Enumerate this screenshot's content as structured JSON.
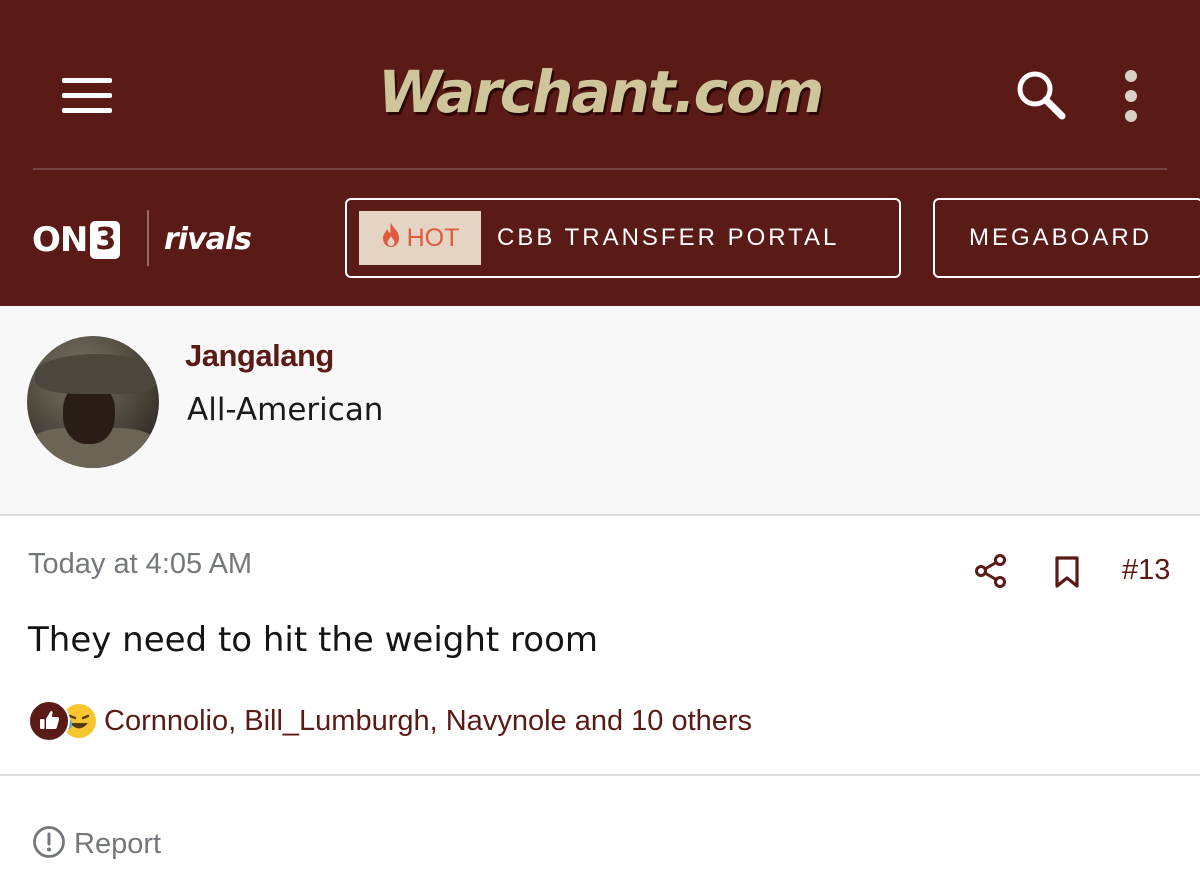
{
  "colors": {
    "brand": "#5a1a16",
    "logo": "#cfc59a",
    "hot_badge_bg": "#e3d4c4",
    "hot_text": "#e05a3c",
    "muted_text": "#74777c"
  },
  "header": {
    "menu_icon": "hamburger-menu-icon",
    "logo_text": "Warchant.com",
    "search_icon": "search-icon",
    "more_icon": "more-vertical-icon"
  },
  "brands": {
    "on3_prefix": "ON",
    "on3_box": "3",
    "rivals": "rivals"
  },
  "nav": {
    "hot_label": "HOT",
    "hot_icon": "flame-icon",
    "hot_link": "CBB TRANSFER PORTAL",
    "megaboard": "MEGABOARD"
  },
  "author": {
    "name": "Jangalang",
    "title": "All-American"
  },
  "post": {
    "timestamp": "Today at 4:05 AM",
    "share_icon": "share-icon",
    "bookmark_icon": "bookmark-icon",
    "number": "#13",
    "body": "They need to hit the weight room",
    "reactions": {
      "icons": [
        "like-icon",
        "laugh-icon"
      ],
      "text": "Cornnolio, Bill_Lumburgh, Navynole and 10 others"
    },
    "report_label": "Report",
    "report_icon": "alert-circle-icon"
  }
}
